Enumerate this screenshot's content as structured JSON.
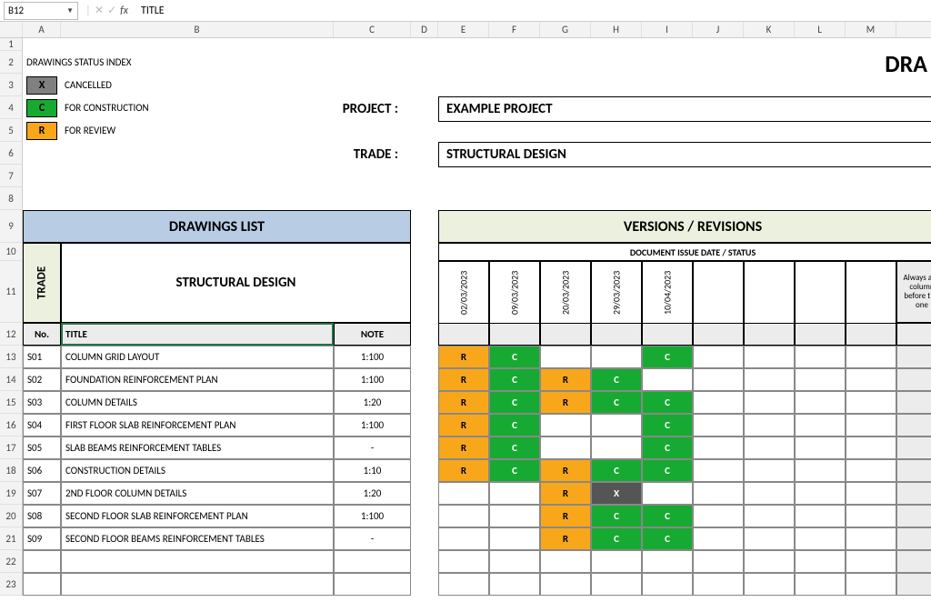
{
  "formulaBar": {
    "nameBox": "B12",
    "formula": "TITLE"
  },
  "columns": [
    "A",
    "B",
    "C",
    "D",
    "E",
    "F",
    "G",
    "H",
    "I",
    "J",
    "K",
    "L",
    "M"
  ],
  "rowNumbers": [
    "1",
    "2",
    "3",
    "4",
    "5",
    "6",
    "7",
    "8",
    "9",
    "10",
    "11",
    "12",
    "13",
    "14",
    "15",
    "16",
    "17",
    "18",
    "19",
    "20",
    "21",
    "22",
    "23"
  ],
  "legend": {
    "title": "DRAWINGS STATUS INDEX",
    "items": [
      {
        "code": "X",
        "label": "CANCELLED",
        "class": "sbox-x"
      },
      {
        "code": "C",
        "label": "FOR CONSTRUCTION",
        "class": "sbox-c"
      },
      {
        "code": "R",
        "label": "FOR REVIEW",
        "class": "sbox-r"
      }
    ]
  },
  "bigTitle": "DRA",
  "fields": {
    "projectLabel": "PROJECT :",
    "projectValue": "EXAMPLE PROJECT",
    "tradeLabel": "TRADE :",
    "tradeValue": "STRUCTURAL DESIGN"
  },
  "headers": {
    "drawingsList": "DRAWINGS LIST",
    "versions": "VERSIONS / REVISIONS",
    "issue": "DOCUMENT ISSUE DATE / STATUS",
    "tradeVert": "TRADE",
    "structural": "STRUCTURAL DESIGN",
    "no": "No.",
    "title": "TITLE",
    "note": "NOTE",
    "addCol": "Always add column before this one"
  },
  "dates": [
    "02/03/2023",
    "09/03/2023",
    "20/03/2023",
    "29/03/2023",
    "10/04/2023",
    "",
    "",
    "",
    ""
  ],
  "drawings": [
    {
      "no": "S01",
      "title": "COLUMN GRID LAYOUT",
      "note": "1:100",
      "rev": [
        "R",
        "C",
        "",
        "",
        "C",
        "",
        "",
        "",
        ""
      ]
    },
    {
      "no": "S02",
      "title": "FOUNDATION REINFORCEMENT PLAN",
      "note": "1:100",
      "rev": [
        "R",
        "C",
        "R",
        "C",
        "",
        "",
        "",
        "",
        ""
      ]
    },
    {
      "no": "S03",
      "title": "COLUMN DETAILS",
      "note": "1:20",
      "rev": [
        "R",
        "C",
        "R",
        "C",
        "C",
        "",
        "",
        "",
        ""
      ]
    },
    {
      "no": "S04",
      "title": "FIRST FLOOR SLAB REINFORCEMENT PLAN",
      "note": "1:100",
      "rev": [
        "R",
        "C",
        "",
        "",
        "C",
        "",
        "",
        "",
        ""
      ]
    },
    {
      "no": "S05",
      "title": "SLAB BEAMS REINFORCEMENT TABLES",
      "note": "-",
      "rev": [
        "R",
        "C",
        "",
        "",
        "C",
        "",
        "",
        "",
        ""
      ]
    },
    {
      "no": "S06",
      "title": "CONSTRUCTION DETAILS",
      "note": "1:10",
      "rev": [
        "R",
        "C",
        "R",
        "C",
        "C",
        "",
        "",
        "",
        ""
      ]
    },
    {
      "no": "S07",
      "title": "2ND FLOOR COLUMN DETAILS",
      "note": "1:20",
      "rev": [
        "",
        "",
        "R",
        "X",
        "",
        "",
        "",
        "",
        ""
      ]
    },
    {
      "no": "S08",
      "title": "SECOND FLOOR SLAB REINFORCEMENT PLAN",
      "note": "1:100",
      "rev": [
        "",
        "",
        "R",
        "C",
        "C",
        "",
        "",
        "",
        ""
      ]
    },
    {
      "no": "S09",
      "title": "SECOND FLOOR BEAMS REINFORCEMENT TABLES",
      "note": "-",
      "rev": [
        "",
        "",
        "R",
        "C",
        "C",
        "",
        "",
        "",
        ""
      ]
    }
  ]
}
